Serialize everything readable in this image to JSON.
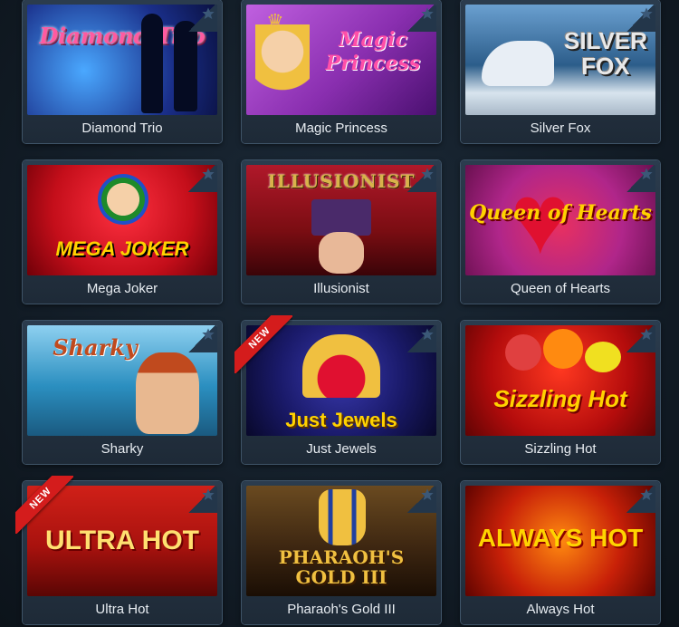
{
  "games": [
    {
      "caption": "Diamond Trio",
      "art": "Diamond Trio",
      "theme": "#1a2f8a",
      "accent": "#ff5aa0",
      "new": false
    },
    {
      "caption": "Magic Princess",
      "art": "Magic Princess",
      "theme": "#8a2fb0",
      "accent": "#ff4fa8",
      "new": false
    },
    {
      "caption": "Silver Fox",
      "art": "SILVER FOX",
      "theme": "#2c5d8a",
      "accent": "#e8e8e8",
      "new": false
    },
    {
      "caption": "Mega Joker",
      "art": "MEGA JOKER",
      "theme": "#c40e1a",
      "accent": "#ffd200",
      "new": false
    },
    {
      "caption": "Illusionist",
      "art": "ILLUSIONIST",
      "theme": "#7a0d12",
      "accent": "#d9b24a",
      "new": false
    },
    {
      "caption": "Queen of Hearts",
      "art": "Queen of Hearts",
      "theme": "#b0268a",
      "accent": "#ffd200",
      "new": false
    },
    {
      "caption": "Sharky",
      "art": "Sharky",
      "theme": "#2b8fc0",
      "accent": "#c04a1e",
      "new": false
    },
    {
      "caption": "Just Jewels",
      "art": "Just Jewels",
      "theme": "#1a1a6a",
      "accent": "#ffd200",
      "new": true
    },
    {
      "caption": "Sizzling Hot",
      "art": "Sizzling Hot",
      "theme": "#b40c0c",
      "accent": "#ffd200",
      "new": false
    },
    {
      "caption": "Ultra Hot",
      "art": "ULTRA HOT",
      "theme": "#a8120e",
      "accent": "#ffe070",
      "new": true
    },
    {
      "caption": "Pharaoh's Gold III",
      "art": "PHARAOH'S GOLD III",
      "theme": "#3a2410",
      "accent": "#f0c040",
      "new": false
    },
    {
      "caption": "Always Hot",
      "art": "ALWAYS HOT",
      "theme": "#c82008",
      "accent": "#ffd400",
      "new": false
    }
  ],
  "badge_text": "NEW",
  "colors": {
    "card_bg": "#24323f",
    "caption_text": "#e8edf2",
    "ribbon": "#d41c1c"
  }
}
